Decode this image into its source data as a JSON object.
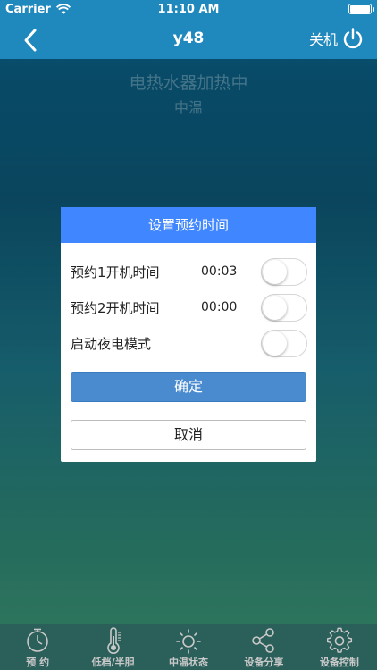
{
  "status_bar": {
    "carrier": "Carrier",
    "time": "11:10 AM"
  },
  "nav": {
    "title": "y48",
    "power_label": "关机"
  },
  "background_status": {
    "line1": "电热水器加热中",
    "line2": "中温"
  },
  "dialog": {
    "title": "设置预约时间",
    "rows": [
      {
        "label": "预约1开机时间",
        "time": "00:03",
        "toggle_on": false
      },
      {
        "label": "预约2开机时间",
        "time": "00:00",
        "toggle_on": false
      },
      {
        "label": "启动夜电模式",
        "toggle_on": false
      }
    ],
    "confirm_label": "确定",
    "cancel_label": "取消"
  },
  "tabs": [
    {
      "label": "预 约",
      "icon": "clock-icon"
    },
    {
      "label": "低档/半胆",
      "icon": "thermometer-icon"
    },
    {
      "label": "中温状态",
      "icon": "sun-icon"
    },
    {
      "label": "设备分享",
      "icon": "share-icon"
    },
    {
      "label": "设备控制",
      "icon": "gear-icon"
    }
  ],
  "colors": {
    "nav_blue": "#1f88bd",
    "dialog_header": "#3f86ff",
    "confirm_button": "#4a8bd0",
    "tab_bar": "#2b5f5a"
  }
}
